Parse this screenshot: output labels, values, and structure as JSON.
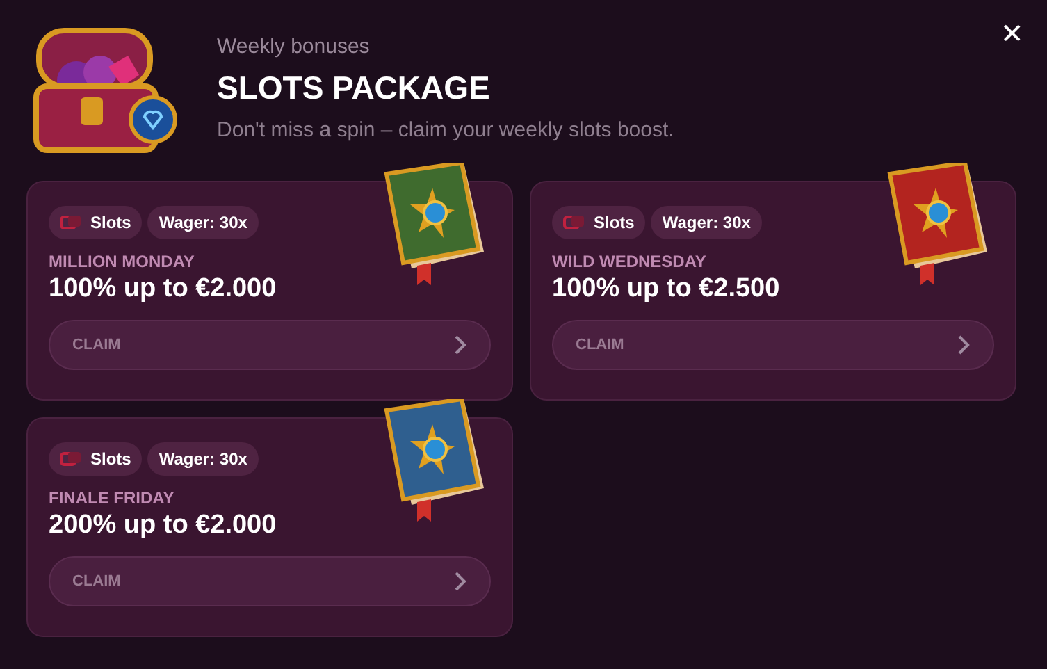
{
  "header": {
    "eyebrow": "Weekly bonuses",
    "title": "SLOTS PACKAGE",
    "subtitle": "Don't miss a spin – claim your weekly slots boost.",
    "close": "✕"
  },
  "offers": [
    {
      "tags": [
        {
          "kind": "category",
          "label": "Slots"
        },
        {
          "kind": "plain",
          "label": "Wager: 30x"
        }
      ],
      "name": "MILLION MONDAY",
      "amount": "100% up to €2.000",
      "action": "CLAIM",
      "color": "#3f6b2e"
    },
    {
      "tags": [
        {
          "kind": "category",
          "label": "Slots"
        },
        {
          "kind": "plain",
          "label": "Wager: 30x"
        }
      ],
      "name": "WILD WEDNESDAY",
      "amount": "100% up to €2.500",
      "action": "CLAIM",
      "color": "#b3241f"
    },
    {
      "tags": [
        {
          "kind": "category",
          "label": "Slots"
        },
        {
          "kind": "plain",
          "label": "Wager: 30x"
        }
      ],
      "name": "FINALE FRIDAY",
      "amount": "200% up to €2.000",
      "action": "CLAIM",
      "color": "#2f5f8f"
    }
  ]
}
